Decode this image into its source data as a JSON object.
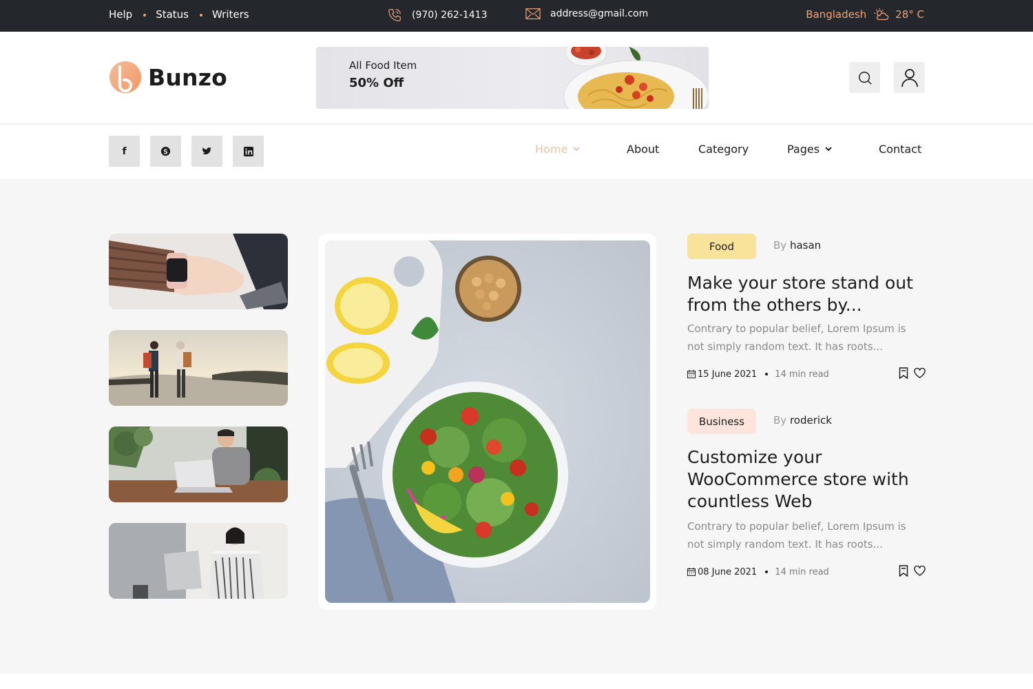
{
  "topbar": {
    "links": [
      "Help",
      "Status",
      "Writers"
    ],
    "phone": "(970) 262-1413",
    "email": "address@gmail.com",
    "location": "Bangladesh",
    "temperature": "28° C"
  },
  "header": {
    "logo_text": "Bunzo",
    "banner": {
      "line1": "All Food Item",
      "line2": "50% Off"
    }
  },
  "social": [
    "facebook",
    "skype",
    "twitter",
    "linkedin"
  ],
  "nav": {
    "items": [
      {
        "label": "Home",
        "active": true,
        "dropdown": true
      },
      {
        "label": "About"
      },
      {
        "label": "Category"
      },
      {
        "label": "Pages",
        "dropdown": true
      },
      {
        "label": "Contact"
      }
    ]
  },
  "posts": [
    {
      "tag": "Food",
      "tag_color": "#f9e29a",
      "by_label": "By",
      "author": "hasan",
      "title": "Make your store stand out from the others by...",
      "excerpt": "Contrary to popular belief, Lorem Ipsum is not simply random text. It has roots...",
      "date": "15 June 2021",
      "read_time": "14 min read"
    },
    {
      "tag": "Business",
      "tag_color": "#fde5dc",
      "by_label": "By",
      "author": "roderick",
      "title": "Customize your WooCommerce store with countless Web",
      "excerpt": "Contrary to popular belief, Lorem Ipsum is not simply random text. It has roots...",
      "date": "08 June 2021",
      "read_time": "14 min read"
    }
  ],
  "colors": {
    "accent": "#f2a377",
    "topbar_bg": "#24272b"
  }
}
